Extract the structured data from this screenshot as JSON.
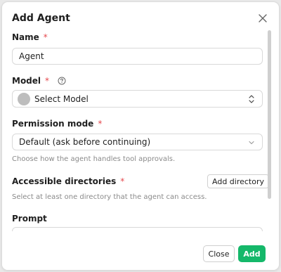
{
  "dialog": {
    "title": "Add Agent",
    "close_icon": "close-icon"
  },
  "form": {
    "name": {
      "label": "Name",
      "required_mark": "*",
      "value": "Agent"
    },
    "model": {
      "label": "Model",
      "required_mark": "*",
      "help_icon": "question-circle-icon",
      "value": "Select Model",
      "chevron_icon": "chevron-up-down-icon"
    },
    "permission_mode": {
      "label": "Permission mode",
      "required_mark": "*",
      "value": "Default (ask before continuing)",
      "hint": "Choose how the agent handles tool approvals.",
      "chevron_icon": "chevron-down-icon"
    },
    "accessible_directories": {
      "label": "Accessible directories",
      "required_mark": "*",
      "add_button": "Add directory",
      "hint": "Select at least one directory that the agent can access."
    },
    "prompt": {
      "label": "Prompt"
    }
  },
  "footer": {
    "close_label": "Close",
    "add_label": "Add"
  },
  "colors": {
    "accent": "#15b86a",
    "required": "#e5484d"
  }
}
